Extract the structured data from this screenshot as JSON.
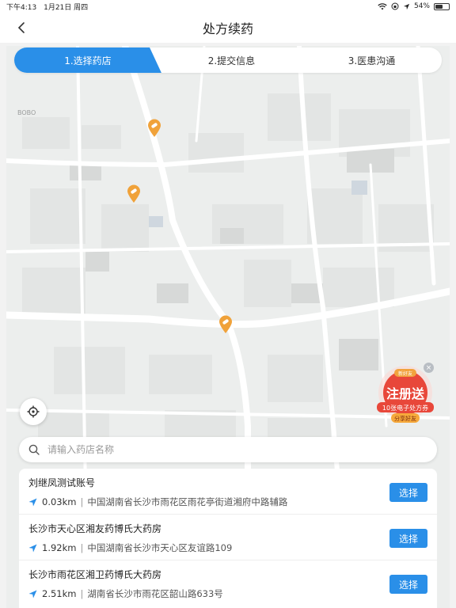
{
  "status_bar": {
    "time": "下午4:13",
    "date": "1月21日 周四",
    "battery": "54%",
    "battery_level": 0.54
  },
  "header": {
    "title": "处方续药",
    "back_icon": "chevron-left-icon"
  },
  "tabs": [
    {
      "label": "1.选择药店",
      "active": true
    },
    {
      "label": "2.提交信息",
      "active": false
    },
    {
      "label": "3.医患沟通",
      "active": false
    }
  ],
  "map": {
    "labels": [
      "BOBO"
    ],
    "marker_icon": "pharmacy-marker-icon",
    "locate_icon": "crosshair-icon"
  },
  "promo": {
    "badge": "新好友",
    "headline": "注册送",
    "subline": "10张电子处方券",
    "cta": "分享好友",
    "close": "×"
  },
  "search": {
    "placeholder": "请输入药店名称"
  },
  "pharmacies": [
    {
      "name": "刘继凤测试账号",
      "distance": "0.03km",
      "address": "中国湖南省长沙市雨花区雨花亭街道湘府中路辅路",
      "button": "选择"
    },
    {
      "name": "长沙市天心区湘友药博氏大药房",
      "distance": "1.92km",
      "address": "中国湖南省长沙市天心区友谊路109",
      "button": "选择"
    },
    {
      "name": "长沙市雨花区湘卫药博氏大药房",
      "distance": "2.51km",
      "address": "湖南省长沙市雨花区韶山路633号",
      "button": "选择"
    }
  ],
  "colors": {
    "accent": "#2a8fe8",
    "marker": "#f0a23a",
    "promo": "#e8473a"
  }
}
